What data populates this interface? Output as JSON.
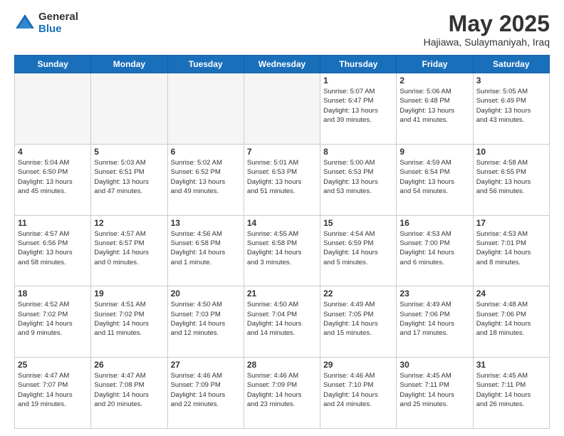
{
  "logo": {
    "general": "General",
    "blue": "Blue"
  },
  "title": "May 2025",
  "location": "Hajiawa, Sulaymaniyah, Iraq",
  "weekdays": [
    "Sunday",
    "Monday",
    "Tuesday",
    "Wednesday",
    "Thursday",
    "Friday",
    "Saturday"
  ],
  "weeks": [
    [
      {
        "day": "",
        "info": "",
        "empty": true
      },
      {
        "day": "",
        "info": "",
        "empty": true
      },
      {
        "day": "",
        "info": "",
        "empty": true
      },
      {
        "day": "",
        "info": "",
        "empty": true
      },
      {
        "day": "1",
        "info": "Sunrise: 5:07 AM\nSunset: 6:47 PM\nDaylight: 13 hours\nand 39 minutes."
      },
      {
        "day": "2",
        "info": "Sunrise: 5:06 AM\nSunset: 6:48 PM\nDaylight: 13 hours\nand 41 minutes."
      },
      {
        "day": "3",
        "info": "Sunrise: 5:05 AM\nSunset: 6:49 PM\nDaylight: 13 hours\nand 43 minutes."
      }
    ],
    [
      {
        "day": "4",
        "info": "Sunrise: 5:04 AM\nSunset: 6:50 PM\nDaylight: 13 hours\nand 45 minutes."
      },
      {
        "day": "5",
        "info": "Sunrise: 5:03 AM\nSunset: 6:51 PM\nDaylight: 13 hours\nand 47 minutes."
      },
      {
        "day": "6",
        "info": "Sunrise: 5:02 AM\nSunset: 6:52 PM\nDaylight: 13 hours\nand 49 minutes."
      },
      {
        "day": "7",
        "info": "Sunrise: 5:01 AM\nSunset: 6:53 PM\nDaylight: 13 hours\nand 51 minutes."
      },
      {
        "day": "8",
        "info": "Sunrise: 5:00 AM\nSunset: 6:53 PM\nDaylight: 13 hours\nand 53 minutes."
      },
      {
        "day": "9",
        "info": "Sunrise: 4:59 AM\nSunset: 6:54 PM\nDaylight: 13 hours\nand 54 minutes."
      },
      {
        "day": "10",
        "info": "Sunrise: 4:58 AM\nSunset: 6:55 PM\nDaylight: 13 hours\nand 56 minutes."
      }
    ],
    [
      {
        "day": "11",
        "info": "Sunrise: 4:57 AM\nSunset: 6:56 PM\nDaylight: 13 hours\nand 58 minutes."
      },
      {
        "day": "12",
        "info": "Sunrise: 4:57 AM\nSunset: 6:57 PM\nDaylight: 14 hours\nand 0 minutes."
      },
      {
        "day": "13",
        "info": "Sunrise: 4:56 AM\nSunset: 6:58 PM\nDaylight: 14 hours\nand 1 minute."
      },
      {
        "day": "14",
        "info": "Sunrise: 4:55 AM\nSunset: 6:58 PM\nDaylight: 14 hours\nand 3 minutes."
      },
      {
        "day": "15",
        "info": "Sunrise: 4:54 AM\nSunset: 6:59 PM\nDaylight: 14 hours\nand 5 minutes."
      },
      {
        "day": "16",
        "info": "Sunrise: 4:53 AM\nSunset: 7:00 PM\nDaylight: 14 hours\nand 6 minutes."
      },
      {
        "day": "17",
        "info": "Sunrise: 4:53 AM\nSunset: 7:01 PM\nDaylight: 14 hours\nand 8 minutes."
      }
    ],
    [
      {
        "day": "18",
        "info": "Sunrise: 4:52 AM\nSunset: 7:02 PM\nDaylight: 14 hours\nand 9 minutes."
      },
      {
        "day": "19",
        "info": "Sunrise: 4:51 AM\nSunset: 7:02 PM\nDaylight: 14 hours\nand 11 minutes."
      },
      {
        "day": "20",
        "info": "Sunrise: 4:50 AM\nSunset: 7:03 PM\nDaylight: 14 hours\nand 12 minutes."
      },
      {
        "day": "21",
        "info": "Sunrise: 4:50 AM\nSunset: 7:04 PM\nDaylight: 14 hours\nand 14 minutes."
      },
      {
        "day": "22",
        "info": "Sunrise: 4:49 AM\nSunset: 7:05 PM\nDaylight: 14 hours\nand 15 minutes."
      },
      {
        "day": "23",
        "info": "Sunrise: 4:49 AM\nSunset: 7:06 PM\nDaylight: 14 hours\nand 17 minutes."
      },
      {
        "day": "24",
        "info": "Sunrise: 4:48 AM\nSunset: 7:06 PM\nDaylight: 14 hours\nand 18 minutes."
      }
    ],
    [
      {
        "day": "25",
        "info": "Sunrise: 4:47 AM\nSunset: 7:07 PM\nDaylight: 14 hours\nand 19 minutes."
      },
      {
        "day": "26",
        "info": "Sunrise: 4:47 AM\nSunset: 7:08 PM\nDaylight: 14 hours\nand 20 minutes."
      },
      {
        "day": "27",
        "info": "Sunrise: 4:46 AM\nSunset: 7:09 PM\nDaylight: 14 hours\nand 22 minutes."
      },
      {
        "day": "28",
        "info": "Sunrise: 4:46 AM\nSunset: 7:09 PM\nDaylight: 14 hours\nand 23 minutes."
      },
      {
        "day": "29",
        "info": "Sunrise: 4:46 AM\nSunset: 7:10 PM\nDaylight: 14 hours\nand 24 minutes."
      },
      {
        "day": "30",
        "info": "Sunrise: 4:45 AM\nSunset: 7:11 PM\nDaylight: 14 hours\nand 25 minutes."
      },
      {
        "day": "31",
        "info": "Sunrise: 4:45 AM\nSunset: 7:11 PM\nDaylight: 14 hours\nand 26 minutes."
      }
    ]
  ]
}
